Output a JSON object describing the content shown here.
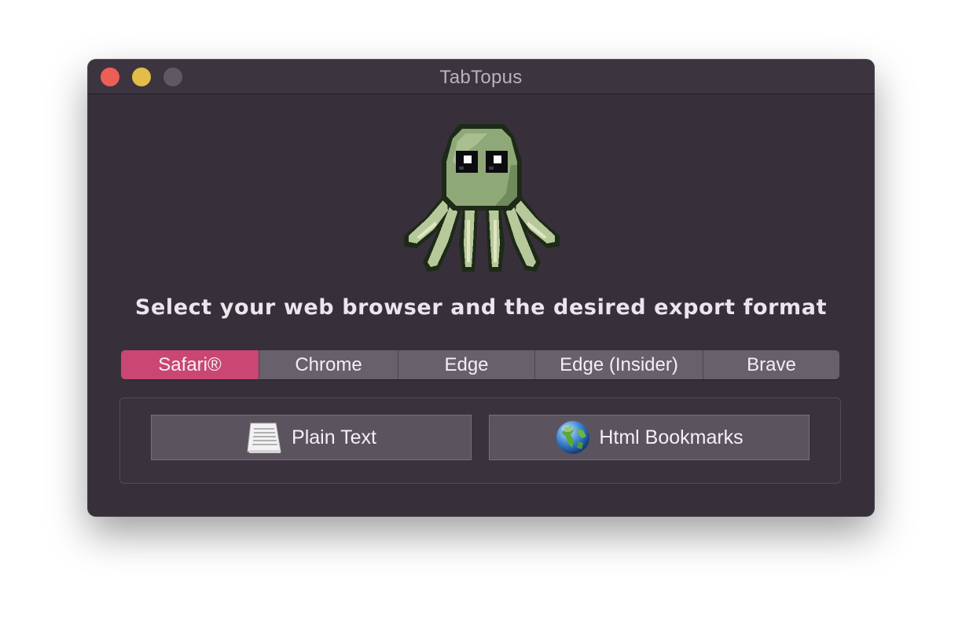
{
  "window": {
    "title": "TabTopus"
  },
  "headline": "Select your web browser and the desired export format",
  "browsers": {
    "selected": "Safari®",
    "items": [
      {
        "label": "Safari®"
      },
      {
        "label": "Chrome"
      },
      {
        "label": "Edge"
      },
      {
        "label": "Edge (Insider)"
      },
      {
        "label": "Brave"
      }
    ]
  },
  "export": {
    "plain_text_label": "Plain Text",
    "plain_text_icon": "document-lines-icon",
    "html_bookmarks_label": "Html Bookmarks",
    "html_bookmarks_icon": "globe-icon"
  },
  "colors": {
    "window_bg": "#37303a",
    "accent_selected": "#c94772",
    "segment_bg": "#67616b",
    "close": "#ec5f57",
    "minimize": "#e2bd47",
    "zoom_inactive": "#5f5963"
  }
}
